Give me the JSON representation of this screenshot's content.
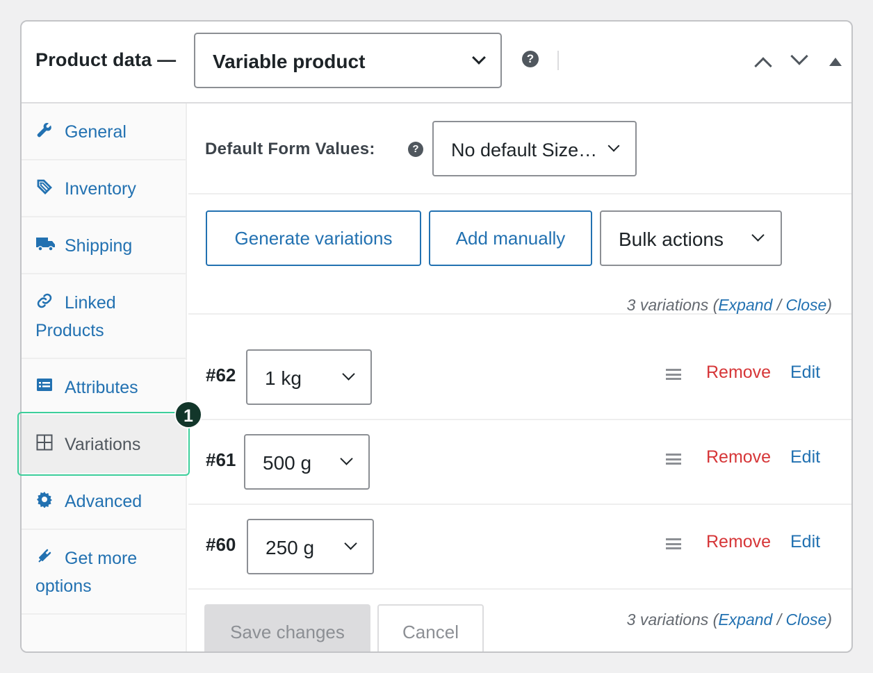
{
  "header": {
    "title": "Product data —",
    "product_type": "Variable product",
    "help": "?"
  },
  "sidebar": {
    "items": [
      {
        "label": "General",
        "icon": "wrench-icon"
      },
      {
        "label": "Inventory",
        "icon": "tag-icon"
      },
      {
        "label": "Shipping",
        "icon": "truck-icon"
      },
      {
        "label": "Linked\nProducts",
        "icon": "link-icon"
      },
      {
        "label": "Attributes",
        "icon": "list-icon"
      },
      {
        "label": "Variations",
        "icon": "grid-icon"
      },
      {
        "label": "Advanced",
        "icon": "gear-icon"
      },
      {
        "label": "Get more\noptions",
        "icon": "plugin-icon"
      }
    ],
    "active": "Variations"
  },
  "callout": {
    "badge": "1"
  },
  "default_form": {
    "label": "Default Form Values:",
    "help": "?",
    "value": "No default Size…"
  },
  "actions": {
    "generate": "Generate variations",
    "add": "Add manually",
    "bulk": "Bulk actions"
  },
  "variation_count": {
    "text": "3 variations (",
    "expand": "Expand",
    "sep": " / ",
    "close": "Close",
    "end": ")"
  },
  "variations": [
    {
      "id": "#62",
      "value": "1 kg",
      "remove": "Remove",
      "edit": "Edit"
    },
    {
      "id": "#61",
      "value": "500 g",
      "remove": "Remove",
      "edit": "Edit"
    },
    {
      "id": "#60",
      "value": "250 g",
      "remove": "Remove",
      "edit": "Edit"
    }
  ],
  "footer": {
    "save": "Save changes",
    "cancel": "Cancel"
  },
  "colors": {
    "accent": "#2271b1",
    "danger": "#d63638",
    "highlight": "#3ccf9b",
    "badge": "#12362a"
  }
}
